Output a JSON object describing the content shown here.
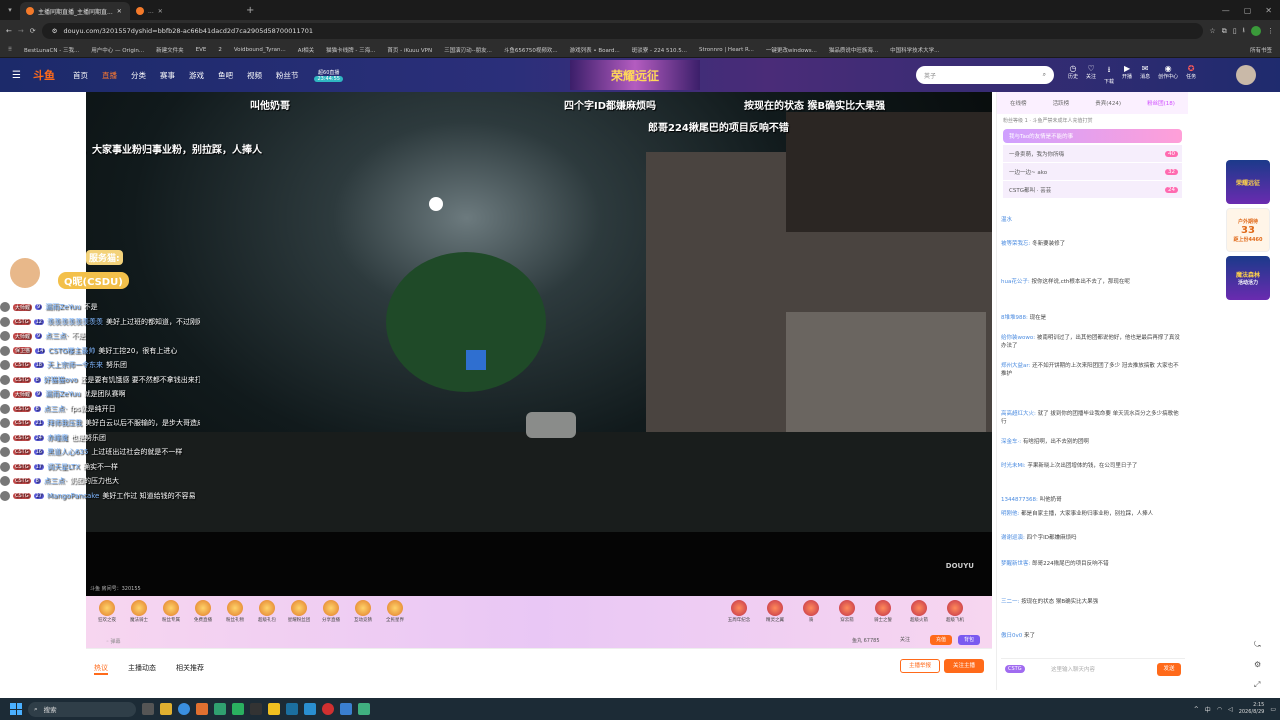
{
  "browser": {
    "tabs": [
      {
        "title": "主播同期直播_主播同期直..."
      },
      {
        "title": "..."
      }
    ],
    "url": "douyu.com/3201557dyshid=bbfb28-ac66b41dacd2d7ca2905d58700011701",
    "bookmarks": [
      "BestLunaCN - 三我...",
      "用户中心 — Origin...",
      "新建文件夹",
      "EVE",
      "2",
      "Voidbound_Tyran...",
      "AI相关",
      "猫猫卡线牌 - 三海...",
      "首页 - iKuuu VPN",
      "三国演刃动--朋友...",
      "斗鱼656750视频欢...",
      "游戏列表 • Board...",
      "斑驳寮 - 224 510.5...",
      "Stronnro | Heart R...",
      "一键更改windows...",
      "猫品质说中旺族海...",
      "中国科学技术大学..."
    ],
    "all_bookmarks": "所有书签"
  },
  "site": {
    "nav": [
      "首页",
      "直播",
      "分类",
      "赛事",
      "游戏",
      "鱼吧",
      "视频",
      "粉丝节"
    ],
    "active_nav": "直播",
    "promo_badge": "超60直播",
    "promo_sub": "23:44:55",
    "banner_text": "荣耀远征",
    "search_value": "英子",
    "header_icons": [
      {
        "icon": "history-icon",
        "label": "历史"
      },
      {
        "icon": "heart-icon",
        "label": "关注"
      },
      {
        "icon": "download-icon",
        "label": "下载"
      },
      {
        "icon": "broadcast-icon",
        "label": "开播"
      },
      {
        "icon": "chat-icon",
        "label": "消息"
      },
      {
        "icon": "creator-icon",
        "label": "创作中心"
      },
      {
        "icon": "task-icon",
        "label": "任务"
      }
    ]
  },
  "video": {
    "danmaku": [
      "叫他奶哥",
      "四个字ID都嫌麻烦吗",
      "按现在的状态 猴B确实比大果强",
      "郎哥224揪尾巴的项目反响不错",
      "，大家事业粉归事业粉，别拉踩，人捧人"
    ],
    "overlay_name": "Q昵(CSDU)",
    "overlay_title": "服务猫:",
    "watermark": "DOUYU",
    "room_info": "斗鱼 房间号：320155"
  },
  "chat_left": [
    {
      "level": "大师鲤",
      "fan": "9",
      "name": "漏雨ZeYuu",
      "msg": "不是"
    },
    {
      "level": "CSTG",
      "fan": "12",
      "name": "羡羡羡羡羡羡羡羡",
      "msg": "美好上过班的都知道，不过刚刚刚毕业就赚大钱的"
    },
    {
      "level": "大师鲤",
      "fan": "9",
      "name": "点三点·",
      "msg": "不是"
    },
    {
      "level": "保卫猫",
      "fan": "14",
      "name": "CSTG楼主最帅",
      "msg": "美好工控20，很有上进心"
    },
    {
      "level": "CSTG",
      "fan": "18",
      "name": "天上宗师一令东来",
      "msg": "努乐团"
    },
    {
      "level": "CSTG",
      "fan": "8",
      "name": "好猫猫ovo",
      "msg": "还是要有饥饿感 要不然都不拿钱出来打了"
    },
    {
      "level": "大师鲤",
      "fan": "9",
      "name": "漏雨ZeYuu",
      "msg": "就是团队赛啊"
    },
    {
      "level": "CSTG",
      "fan": "8",
      "name": "点三点·",
      "msg": "fps就是纯开日"
    },
    {
      "level": "CSTG",
      "fan": "21",
      "name": "拜师我压我",
      "msg": "美好白云以后不服输的，是步大哥造成了都忍着窝宽"
    },
    {
      "level": "CSTG",
      "fan": "24",
      "name": "赤瞳魔",
      "msg": "也是努乐团"
    },
    {
      "level": "CSTG",
      "fan": "16",
      "name": "黑道人心635",
      "msg": "上过班出过社会的就是不一样"
    },
    {
      "level": "CSTG",
      "fan": "17",
      "name": "调天星LTX",
      "msg": "确实不一样"
    },
    {
      "level": "CSTG",
      "fan": "8",
      "name": "点三点·",
      "msg": "奶团的压力也大"
    },
    {
      "level": "CSTG",
      "fan": "27",
      "name": "MangoPancake",
      "msg": "美好工作过 知道给钱的不容易"
    }
  ],
  "gift_bar": {
    "gifts": [
      "狂欢之夜",
      "魔法骑士",
      "粉丝专属",
      "免费直播",
      "粉丝礼物",
      "超级礼包",
      "星耀粉丝团",
      "分享直播",
      "互动竞猜",
      "全民星界"
    ],
    "right_gifts": [
      "五周年纪念",
      "精灵之翼",
      "骑",
      "穿云箭",
      "骑士之誓",
      "超级火箭",
      "超级飞机"
    ],
    "balance_label": "鱼丸 67785",
    "recharge": "充值",
    "backpack": "背包",
    "follow_label": "关注"
  },
  "below_tabs": {
    "tabs": [
      "热议",
      "主播动态",
      "相关推荐"
    ],
    "report": "主播举报",
    "follow_btn": "关注主播"
  },
  "right_panel": {
    "tabs": [
      "在线榜",
      "活跃榜",
      "贵宾(424)",
      "粉丝团(18)"
    ],
    "fans_line": "粉丝等级 1 · 斗鱼严禁未成年人充值打赏",
    "activity": "我与Tao的友情是不能的事",
    "rank": [
      {
        "name": "一身卖萌，我为你所嗨",
        "score": "40"
      },
      {
        "name": "一边一边~ ako",
        "score": "32"
      },
      {
        "name": "CSTG都叫 · 芸芸",
        "score": "24"
      }
    ],
    "messages": [
      {
        "name": "温水",
        "msg": ""
      },
      {
        "name": "被等荣我忘:",
        "msg": "冬新要装修了"
      },
      {
        "name": "hua花公子:",
        "msg": "按你这样说,cth根本出不去了，那现在呢"
      },
      {
        "name": "8堆堆988:",
        "msg": "现在是"
      },
      {
        "name": "给你装wowo:",
        "msg": "被南明训过了，出其他团都说他好，他也是最后再撑了真没办法了"
      },
      {
        "name": "郑州大益ar:",
        "msg": "还不如开饼期的上次来阳团团了多少 冠去推放搞散 大家也不推护"
      },
      {
        "name": "高高超红大火:",
        "msg": "就了 拔到你的团播毕业我命要 单天流水百分之多少搞歌他行"
      },
      {
        "name": "深金车·:",
        "msg": "有啥招啊，出不去别的团啊"
      },
      {
        "name": "时光未Mi:",
        "msg": "芋果新晓上次出团增体的钱，在公司里日子了"
      },
      {
        "name": "1344877368:",
        "msg": "叫他奶哥"
      },
      {
        "name": "明刚他:",
        "msg": "都是自家主播，大家事业粉归事业粉，别拉踩，人捧人"
      },
      {
        "name": "谢谢巡演:",
        "msg": "四个字ID都嫌麻烦吗"
      },
      {
        "name": "梦醒新世客:",
        "msg": "郎哥224揪尾巴的项目反响不错"
      },
      {
        "name": "三二一:",
        "msg": "按现在的状态 猴B确实比大果强"
      },
      {
        "name": "傲日0v0",
        "msg": "来了"
      }
    ],
    "input_placeholder": "这里输入聊天内容",
    "send": "发送",
    "badge": "CSTG"
  },
  "side_cards": [
    "荣耀远征",
    "33",
    "魔法森林"
  ],
  "side_card_sub": [
    "户外期待",
    "距上份4460",
    "活动活力"
  ],
  "taskbar": {
    "search": "搜索",
    "time": "2:15",
    "date": "2026/8/29",
    "lang": "中"
  }
}
